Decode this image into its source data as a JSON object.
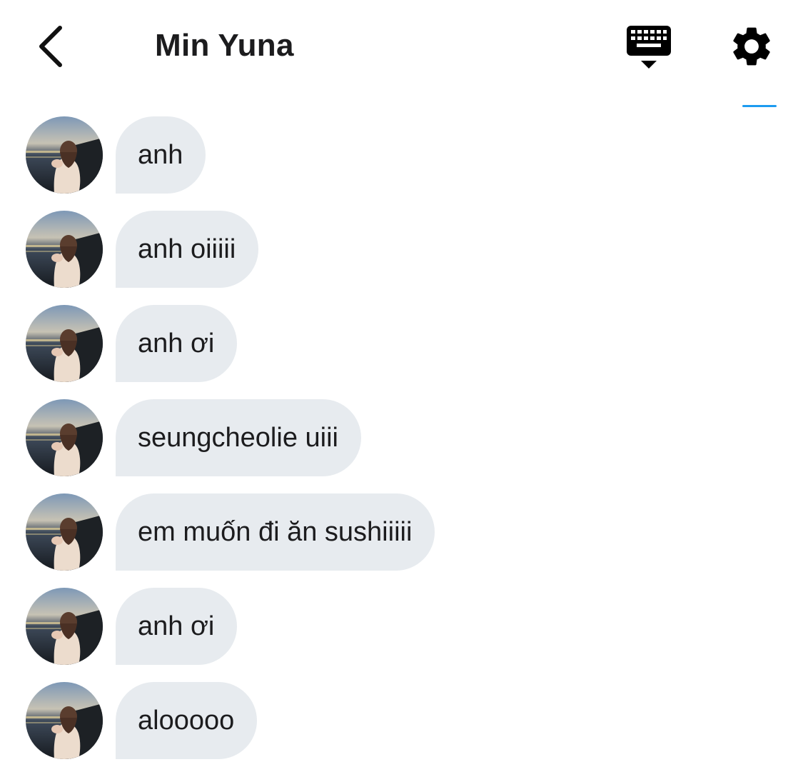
{
  "header": {
    "title": "Min Yuna",
    "back_icon": "chevron-left-icon",
    "keyboard_icon": "keyboard-icon",
    "settings_icon": "gear-icon"
  },
  "colors": {
    "bubble": "#e7ebef",
    "accent": "#1d9bf0",
    "text": "#1c1c1e"
  },
  "messages": [
    {
      "text": "anh"
    },
    {
      "text": "anh oiiiii"
    },
    {
      "text": "anh ơi"
    },
    {
      "text": "seungcheolie uiii"
    },
    {
      "text": "em muốn đi ăn sushiiiii"
    },
    {
      "text": "anh ơi"
    },
    {
      "text": "alooooo"
    }
  ]
}
